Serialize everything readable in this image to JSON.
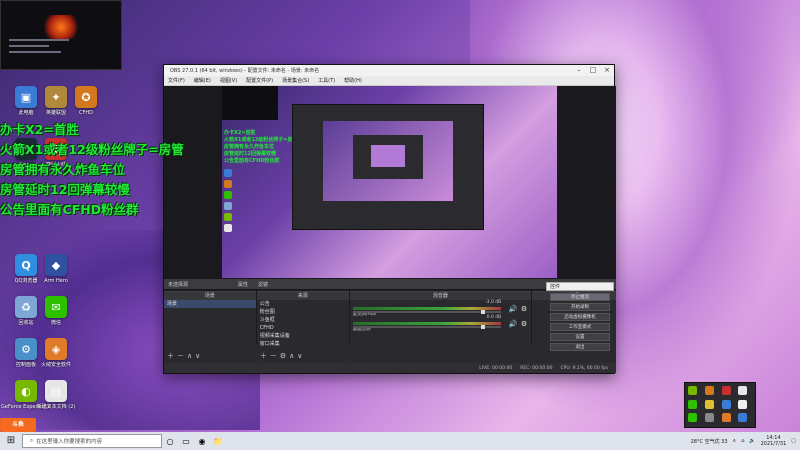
{
  "overlay": {
    "lines": [
      "办卡X2=首胜",
      "火箭X1或者12级粉丝牌子=房管",
      "房管拥有永久炸鱼车位",
      "房管延时12回弹幕较慢",
      "公告里面有CFHD粉丝群"
    ]
  },
  "desktop_icons": [
    {
      "label": "此电脑",
      "icon": "computer-icon",
      "color": "#3a7bd5"
    },
    {
      "label": "英雄联盟",
      "icon": "lol-icon",
      "color": "#b08a3a"
    },
    {
      "label": "CFHD",
      "icon": "cfhd-icon",
      "color": "#d4781e"
    },
    {
      "label": "Steam",
      "icon": "steam-icon",
      "color": "#1b2838"
    },
    {
      "label": "穿越火线",
      "icon": "cf-icon",
      "color": "#c83030"
    },
    {
      "label": "QQ浏览器",
      "icon": "qq-browser-icon",
      "color": "#2f8ee0"
    },
    {
      "label": "Arm Hero",
      "icon": "arm-hero-icon",
      "color": "#3050a0"
    },
    {
      "label": "回收站",
      "icon": "recycle-bin-icon",
      "color": "#7fa7d6"
    },
    {
      "label": "微信",
      "icon": "wechat-icon",
      "color": "#2dc100"
    },
    {
      "label": "控制面板",
      "icon": "control-panel-icon",
      "color": "#4a90c8"
    },
    {
      "label": "火绒安全软件",
      "icon": "huorong-icon",
      "color": "#e07b2a"
    },
    {
      "label": "GeForce Experience",
      "icon": "geforce-icon",
      "color": "#76b900"
    },
    {
      "label": "新建文本文档 (2)",
      "icon": "text-file-icon",
      "color": "#e6e6e6"
    }
  ],
  "obs": {
    "title": "OBS 27.0.1 (64 bit, windows) - 配置文件: 未命名 - 场景: 未命名",
    "menu": [
      "文件(F)",
      "编辑(E)",
      "视图(V)",
      "配置文件(P)",
      "场景集合(S)",
      "工具(T)",
      "帮助(H)"
    ],
    "source_bar": {
      "label": "未选择源",
      "properties": "属性",
      "filters": "滤镜"
    },
    "scenes": {
      "header": "场景",
      "items": [
        "场景"
      ]
    },
    "sources": {
      "header": "来源",
      "items": [
        "公告",
        "粉丝图",
        "斗鱼框",
        "CFHD",
        "视频采集设备",
        "窗口采集"
      ]
    },
    "mixer": {
      "header": "混音器",
      "tracks": [
        {
          "name": "麦克风/Aux",
          "db": "-3.0 dB"
        },
        {
          "name": "桌面音频",
          "db": "0.0 dB"
        }
      ]
    },
    "transitions_label": "转场",
    "controls": {
      "header": "控件",
      "buttons": [
        "停止推流",
        "开始录制",
        "启动虚拟摄像机",
        "工作室模式",
        "设置",
        "退出"
      ]
    },
    "status": [
      "LIVE: 00:00:00",
      "REC: 00:00:00",
      "CPU: 9.1%, 60.00 fps"
    ]
  },
  "taskbar": {
    "search_placeholder": "在这里输入你要搜索的内容",
    "weather": "28°C 空气优 33",
    "time": "14:14",
    "date": "2021/7/31"
  },
  "douyu_logo": "斗鱼"
}
